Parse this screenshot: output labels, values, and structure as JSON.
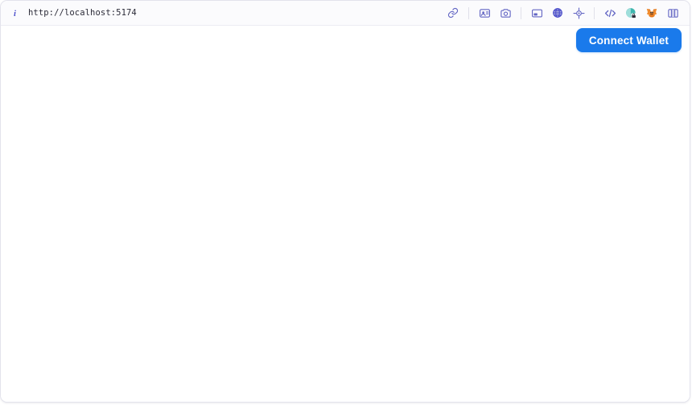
{
  "browser": {
    "address_bar": {
      "info_icon": "info-icon",
      "url": "http://localhost:5174"
    },
    "toolbar_icons": [
      {
        "name": "link-icon",
        "label": "Link"
      },
      {
        "name": "separator",
        "label": ""
      },
      {
        "name": "id-card-icon",
        "label": "Identity"
      },
      {
        "name": "camera-icon",
        "label": "Screenshot"
      },
      {
        "name": "separator",
        "label": ""
      },
      {
        "name": "picture-in-picture-icon",
        "label": "Picture in picture"
      },
      {
        "name": "globe-icon",
        "label": "Translate"
      },
      {
        "name": "crosshair-icon",
        "label": "Inspect element"
      },
      {
        "name": "separator",
        "label": ""
      },
      {
        "name": "code-brackets-icon",
        "label": "Developer tools"
      },
      {
        "name": "shield-lock-icon",
        "label": "Privacy shield"
      },
      {
        "name": "metamask-fox-icon",
        "label": "MetaMask"
      },
      {
        "name": "sidebar-panel-icon",
        "label": "Toggle sidebar"
      }
    ]
  },
  "page": {
    "connect_wallet_label": "Connect Wallet"
  },
  "colors": {
    "accent_blue": "#1a7aeb",
    "icon_purple": "#6366c4",
    "fox_orange": "#e17726",
    "shield_teal": "#2ca8a0",
    "toolbar_bg": "#fbfbfd",
    "border": "#e3e3ec"
  }
}
